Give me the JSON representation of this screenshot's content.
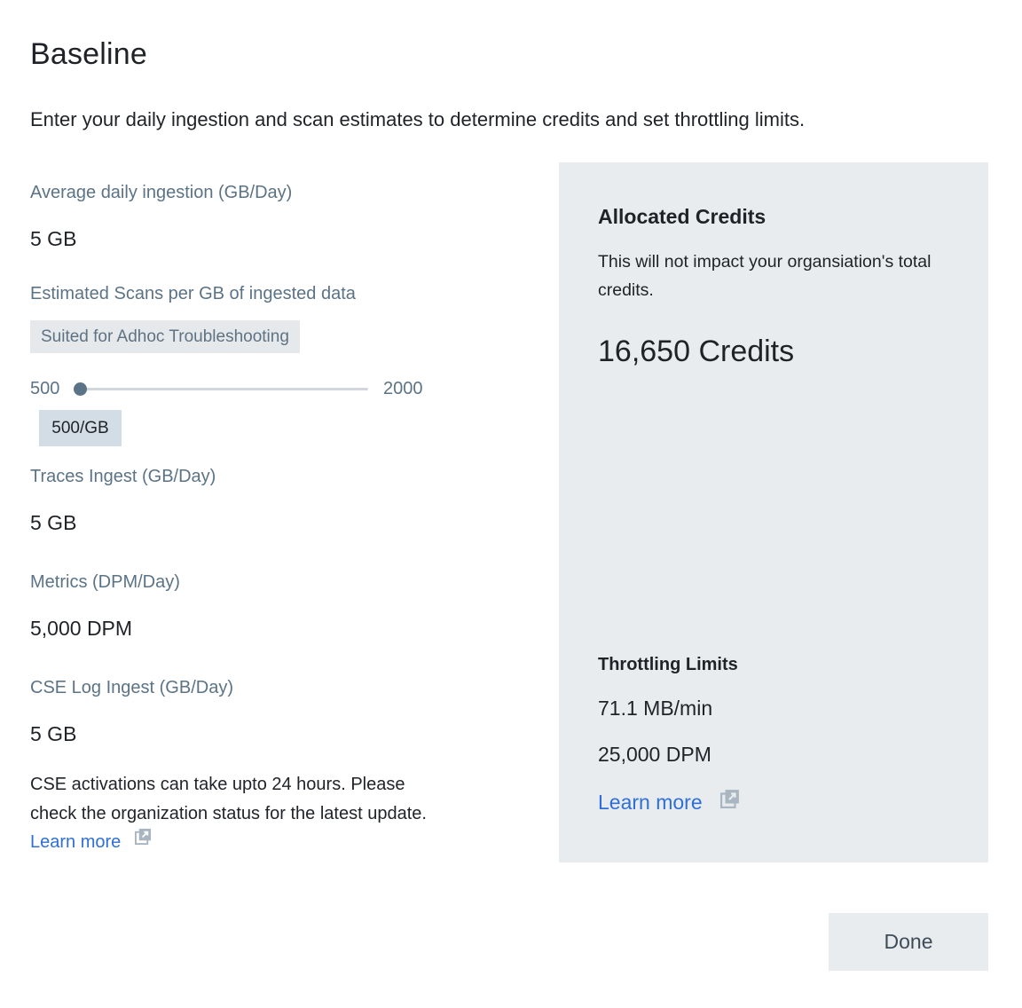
{
  "page": {
    "title": "Baseline",
    "subtitle": "Enter your daily ingestion and scan estimates to determine credits and set throttling limits."
  },
  "fields": {
    "avg_ingestion": {
      "label": "Average daily ingestion (GB/Day)",
      "value": "5 GB"
    },
    "scans": {
      "label": "Estimated Scans per GB of ingested data",
      "chip": "Suited for Adhoc Troubleshooting",
      "slider_min": "500",
      "slider_max": "2000",
      "slider_value_label": "500/GB",
      "slider_value": 500,
      "slider_fraction": 0
    },
    "traces": {
      "label": "Traces Ingest (GB/Day)",
      "value": "5 GB"
    },
    "metrics": {
      "label": "Metrics (DPM/Day)",
      "value": "5,000 DPM"
    },
    "cse": {
      "label": "CSE Log Ingest (GB/Day)",
      "value": "5 GB"
    }
  },
  "note": {
    "text": "CSE activations can take upto 24 hours. Please check the organization status for the latest update.",
    "link": "Learn more"
  },
  "panel": {
    "title": "Allocated Credits",
    "description": "This will not impact your organsiation's total credits.",
    "credits": "16,650 Credits",
    "throttle_title": "Throttling Limits",
    "throttle_values": [
      "71.1 MB/min",
      "25,000 DPM"
    ],
    "link": "Learn more"
  },
  "actions": {
    "done": "Done"
  },
  "icons": {
    "external_link": "external-link-icon"
  },
  "colors": {
    "link": "#2f6fd6",
    "label": "#5b7386",
    "panel_bg": "#e8ecef"
  }
}
